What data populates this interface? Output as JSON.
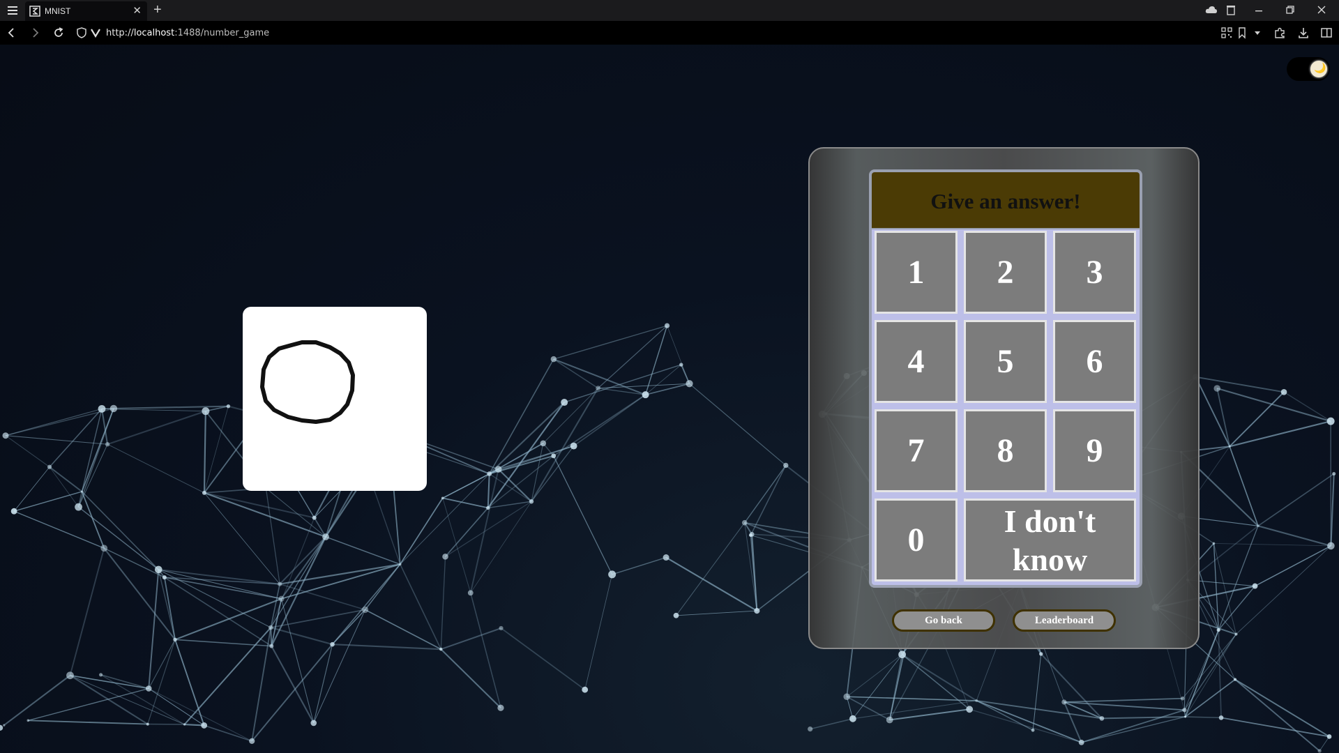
{
  "browser": {
    "tab_title": "MNIST",
    "tab_close": "✕",
    "new_tab": "+",
    "url_prefix": "http://",
    "url_host": "localhost",
    "url_rest": ":1488/number_game"
  },
  "theme_toggle": {
    "icon": "moon-icon",
    "glyph": "🌙"
  },
  "drawing": {
    "description_icon": "drawn-digit"
  },
  "game": {
    "prompt": "Give an answer!",
    "keys": [
      "1",
      "2",
      "3",
      "4",
      "5",
      "6",
      "7",
      "8",
      "9",
      "0"
    ],
    "dont_know_label": "I don't know",
    "go_back_label": "Go back",
    "leaderboard_label": "Leaderboard"
  },
  "colors": {
    "prompt_bg": "#4b3b05",
    "key_bg": "#7c7c7c",
    "keypad_bg": "#bdbfe8",
    "page_bg": "#0a0f1a"
  }
}
